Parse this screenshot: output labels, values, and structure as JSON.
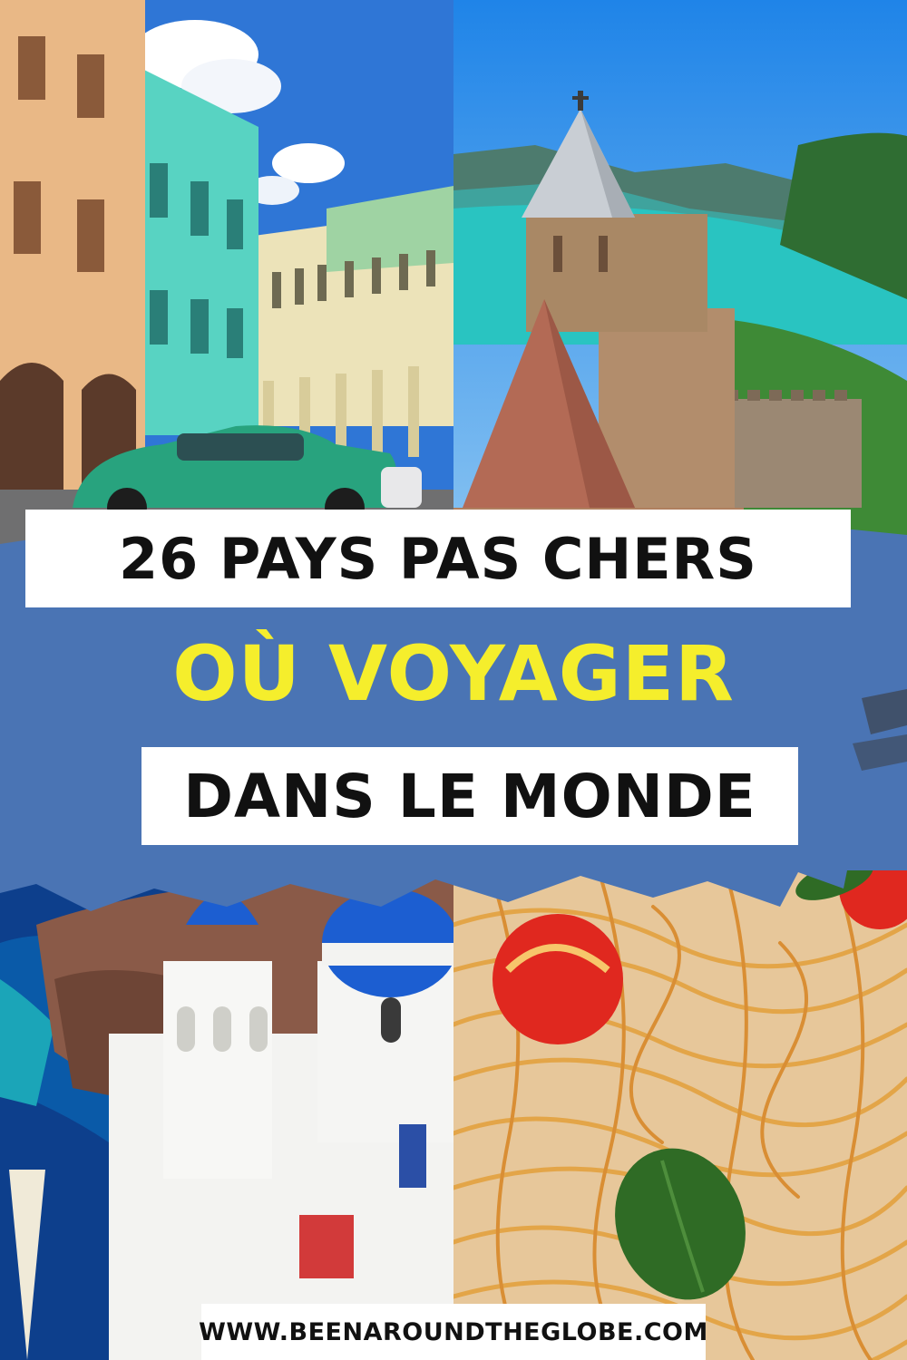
{
  "headline": {
    "line1": "26 PAYS PAS CHERS",
    "line2": "OÙ VOYAGER",
    "line3": "DANS LE MONDE"
  },
  "website": "WWW.BEENAROUNDTHEGLOBE.COM",
  "colors": {
    "band_blue": "#4a74b4",
    "highlight_yellow": "#f5ee2c",
    "label_white": "#ffffff",
    "text_black": "#111111"
  },
  "photos": [
    "havana-street-classic-car",
    "hilltop-fortress-turquoise-lake",
    "santorini-blue-domes",
    "spaghetti-tomato-basil"
  ]
}
